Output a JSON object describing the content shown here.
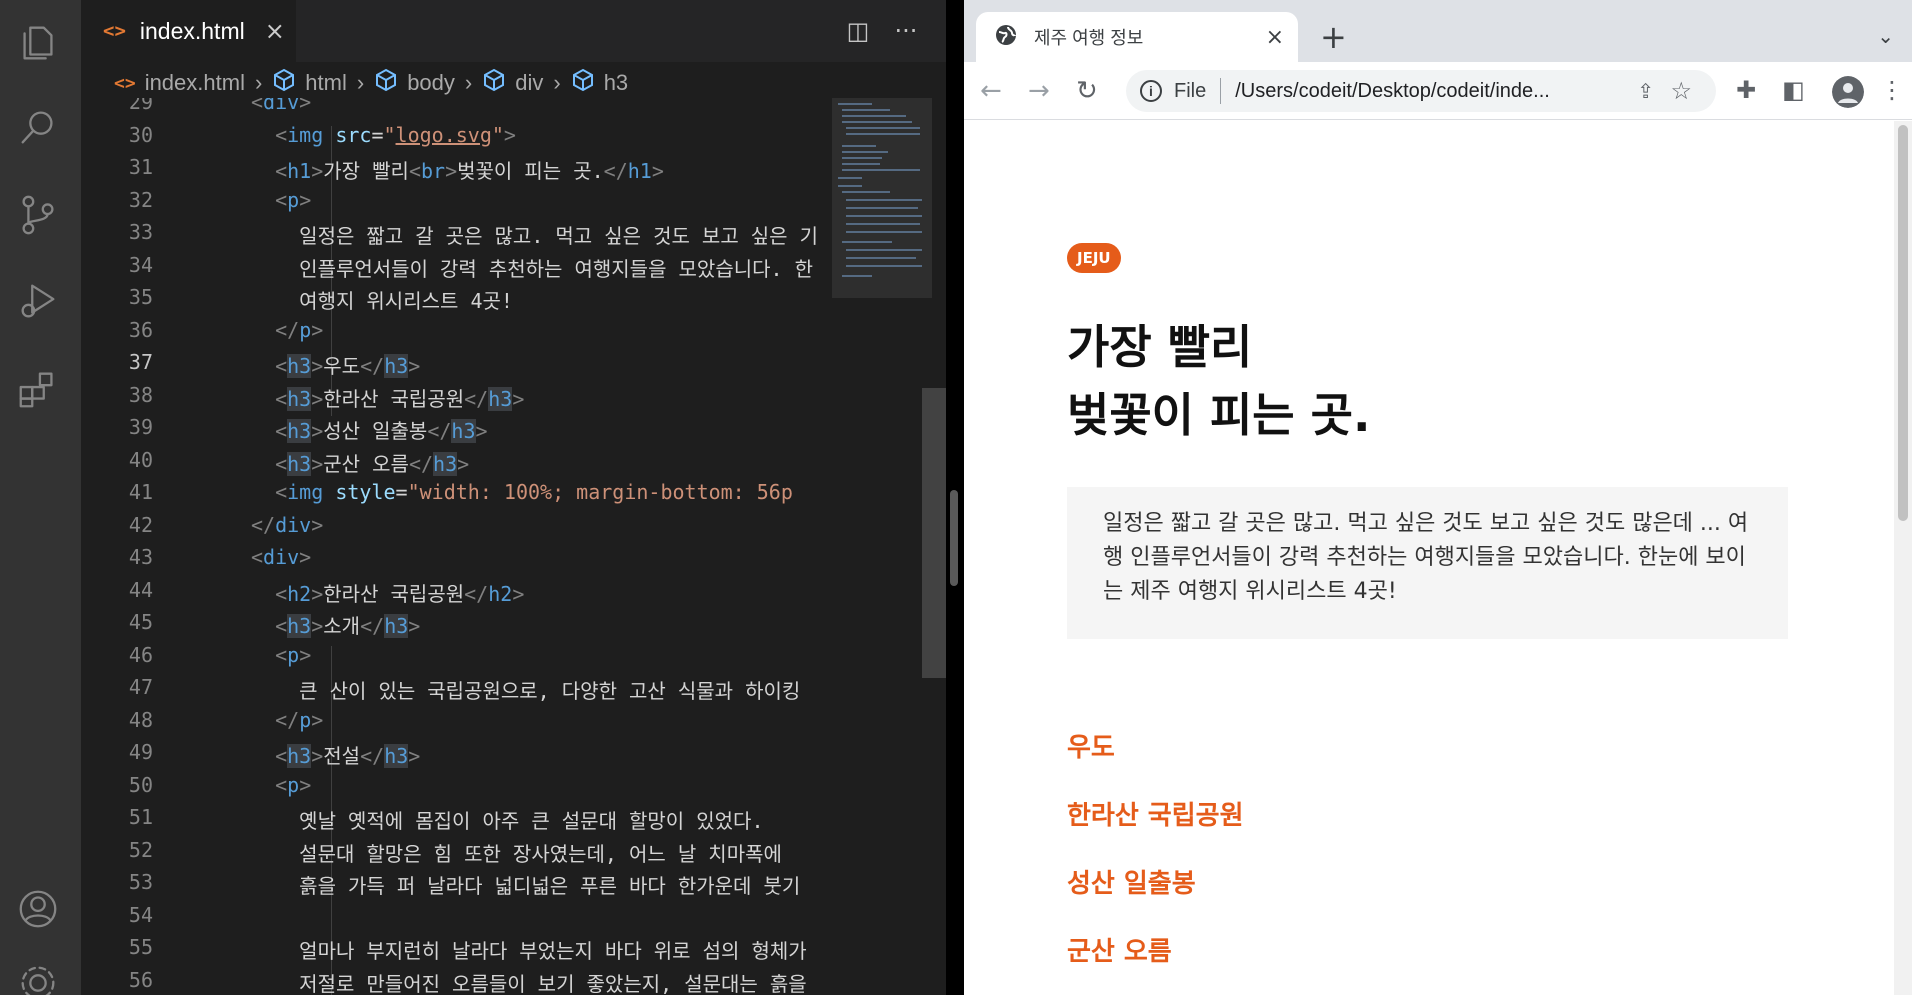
{
  "vscode": {
    "tab": {
      "label": "index.html",
      "close": "×",
      "glyph": "<>"
    },
    "actions": {
      "split": "◫",
      "more": "···"
    },
    "breadcrumb": [
      "index.html",
      "html",
      "body",
      "div",
      "h3"
    ],
    "lines": [
      {
        "n": "29",
        "html": "<span class=\"t-br\">&lt;</span><span class=\"t-tag\">div</span><span class=\"t-br\">&gt;</span>"
      },
      {
        "n": "30",
        "html": "  <span class=\"t-br\">&lt;</span><span class=\"t-tag\">img</span> <span class=\"t-attr\">src</span>=<span class=\"t-str\">\"</span><span class=\"t-link\">logo.svg</span><span class=\"t-str\">\"</span><span class=\"t-br\">&gt;</span>"
      },
      {
        "n": "31",
        "html": "  <span class=\"t-br\">&lt;</span><span class=\"t-tag\">h1</span><span class=\"t-br\">&gt;</span>가장 빨리<span class=\"t-br\">&lt;</span><span class=\"t-tag\">br</span><span class=\"t-br\">&gt;</span>벚꽃이 피는 곳.<span class=\"t-br\">&lt;/</span><span class=\"t-tag\">h1</span><span class=\"t-br\">&gt;</span>"
      },
      {
        "n": "32",
        "html": "  <span class=\"t-br\">&lt;</span><span class=\"t-tag\">p</span><span class=\"t-br\">&gt;</span>"
      },
      {
        "n": "33",
        "html": "    일정은 짧고 갈 곳은 많고. 먹고 싶은 것도 보고 싶은 기"
      },
      {
        "n": "34",
        "html": "    인플루언서들이 강력 추천하는 여행지들을 모았습니다. 한"
      },
      {
        "n": "35",
        "html": "    여행지 위시리스트 4곳!"
      },
      {
        "n": "36",
        "html": "  <span class=\"t-br\">&lt;/</span><span class=\"t-tag\">p</span><span class=\"t-br\">&gt;</span>"
      },
      {
        "n": "37",
        "html": "  <span class=\"t-br\">&lt;</span><span class=\"t-tag hl\">h3</span><span class=\"t-br\">&gt;</span>우도<span class=\"t-br\">&lt;/</span><span class=\"t-tag hl\">h3</span><span class=\"t-br\">&gt;</span>",
        "active": true
      },
      {
        "n": "38",
        "html": "  <span class=\"t-br\">&lt;</span><span class=\"t-tag hl\">h3</span><span class=\"t-br\">&gt;</span>한라산 국립공원<span class=\"t-br\">&lt;/</span><span class=\"t-tag hl\">h3</span><span class=\"t-br\">&gt;</span>"
      },
      {
        "n": "39",
        "html": "  <span class=\"t-br\">&lt;</span><span class=\"t-tag hl\">h3</span><span class=\"t-br\">&gt;</span>성산 일출봉<span class=\"t-br\">&lt;/</span><span class=\"t-tag hl\">h3</span><span class=\"t-br\">&gt;</span>"
      },
      {
        "n": "40",
        "html": "  <span class=\"t-br\">&lt;</span><span class=\"t-tag hl\">h3</span><span class=\"t-br\">&gt;</span>군산 오름<span class=\"t-br\">&lt;/</span><span class=\"t-tag hl\">h3</span><span class=\"t-br\">&gt;</span>"
      },
      {
        "n": "41",
        "html": "  <span class=\"t-br\">&lt;</span><span class=\"t-tag\">img</span> <span class=\"t-attr\">style</span>=<span class=\"t-str\">\"width: 100%; margin-bottom: 56p</span>"
      },
      {
        "n": "42",
        "html": "<span class=\"t-br\">&lt;/</span><span class=\"t-tag\">div</span><span class=\"t-br\">&gt;</span>"
      },
      {
        "n": "43",
        "html": "<span class=\"t-br\">&lt;</span><span class=\"t-tag\">div</span><span class=\"t-br\">&gt;</span>"
      },
      {
        "n": "44",
        "html": "  <span class=\"t-br\">&lt;</span><span class=\"t-tag\">h2</span><span class=\"t-br\">&gt;</span>한라산 국립공원<span class=\"t-br\">&lt;/</span><span class=\"t-tag\">h2</span><span class=\"t-br\">&gt;</span>"
      },
      {
        "n": "45",
        "html": "  <span class=\"t-br\">&lt;</span><span class=\"t-tag hl\">h3</span><span class=\"t-br\">&gt;</span>소개<span class=\"t-br\">&lt;/</span><span class=\"t-tag hl\">h3</span><span class=\"t-br\">&gt;</span>"
      },
      {
        "n": "46",
        "html": "  <span class=\"t-br\">&lt;</span><span class=\"t-tag\">p</span><span class=\"t-br\">&gt;</span>"
      },
      {
        "n": "47",
        "html": "    큰 산이 있는 국립공원으로, 다양한 고산 식물과 하이킹"
      },
      {
        "n": "48",
        "html": "  <span class=\"t-br\">&lt;/</span><span class=\"t-tag\">p</span><span class=\"t-br\">&gt;</span>"
      },
      {
        "n": "49",
        "html": "  <span class=\"t-br\">&lt;</span><span class=\"t-tag hl\">h3</span><span class=\"t-br\">&gt;</span>전설<span class=\"t-br\">&lt;/</span><span class=\"t-tag hl\">h3</span><span class=\"t-br\">&gt;</span>"
      },
      {
        "n": "50",
        "html": "  <span class=\"t-br\">&lt;</span><span class=\"t-tag\">p</span><span class=\"t-br\">&gt;</span>"
      },
      {
        "n": "51",
        "html": "    옛날 옛적에 몸집이 아주 큰 설문대 할망이 있었다."
      },
      {
        "n": "52",
        "html": "    설문대 할망은 힘 또한 장사였는데, 어느 날 치마폭에"
      },
      {
        "n": "53",
        "html": "    흙을 가득 퍼 날라다 넓디넓은 푸른 바다 한가운데 붓기"
      },
      {
        "n": "54",
        "html": ""
      },
      {
        "n": "55",
        "html": "    얼마나 부지런히 날라다 부었는지 바다 위로 섬의 형체가"
      },
      {
        "n": "56",
        "html": "    저절로 만들어진 오름들이 보기 좋았는지, 설문대는 흙을"
      }
    ]
  },
  "browser": {
    "tab_title": "제주 여행 정보",
    "tab_close": "×",
    "new_tab": "+",
    "url_scheme": "File",
    "url": "/Users/codeit/Desktop/codeit/inde..."
  },
  "page": {
    "badge": "JEJU",
    "headline_line1": "가장 빨리",
    "headline_line2": "벚꽃이 피는 곳.",
    "intro": "일정은 짧고 갈 곳은 많고. 먹고 싶은 것도 보고 싶은 것도 많은데 ... 여행 인플루언서들이 강력 추천하는 여행지들을 모았습니다. 한눈에 보이는 제주 여행지 위시리스트 4곳!",
    "destinations": [
      "우도",
      "한라산 국립공원",
      "성산 일출봉",
      "군산 오름"
    ]
  },
  "colors": {
    "accent": "#e55c1a",
    "editor_bg": "#1e1e1e"
  }
}
